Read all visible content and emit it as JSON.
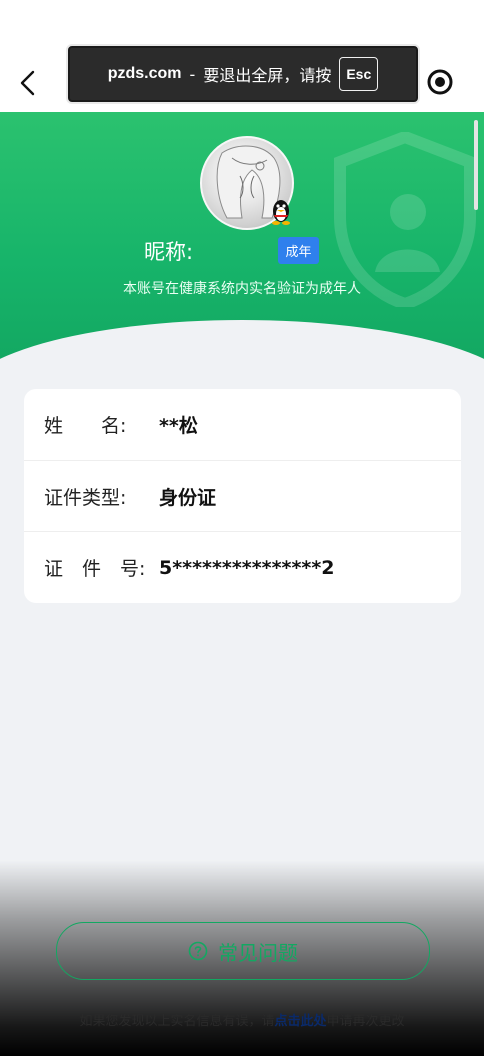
{
  "toast": {
    "domain": "pzds.com",
    "separator": "-",
    "message": "要退出全屏，请按",
    "key": "Esc"
  },
  "header": {
    "back_icon": "chevron-left-icon",
    "menu_icon": "target-icon"
  },
  "profile": {
    "nickname_label": "昵称:",
    "age_badge": "成年",
    "verification_note": "本账号在健康系统内实名验证为成年人",
    "platform_icon": "qq-penguin-icon"
  },
  "info": {
    "rows": [
      {
        "label": "姓　　名:",
        "value": "**松"
      },
      {
        "label": "证件类型:",
        "value": "身份证"
      },
      {
        "label": "证　件　号:",
        "value": "5***************2"
      }
    ]
  },
  "footer": {
    "faq_label": "常见问题",
    "help_prefix": "如果您发现以上实名信息有误，请",
    "help_link": "点击此处",
    "help_suffix": "申请再次更改"
  },
  "colors": {
    "brand_green": "#13a862",
    "badge_blue": "#2f80ed",
    "background": "#f0f2f5"
  }
}
